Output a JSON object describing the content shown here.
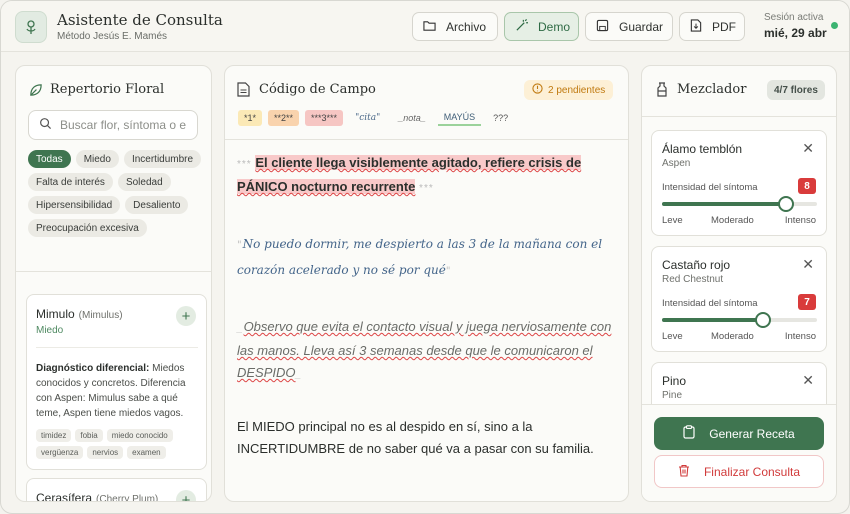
{
  "header": {
    "title": "Asistente de Consulta",
    "subtitle": "Método Jesús E. Mamés",
    "buttons": {
      "archivo": "Archivo",
      "demo": "Demo",
      "guardar": "Guardar",
      "pdf": "PDF"
    },
    "session_label": "Sesión activa",
    "session_date": "mié, 29 abr"
  },
  "repertorio": {
    "title": "Repertorio Floral",
    "search_placeholder": "Buscar flor, síntoma o e",
    "chips": [
      "Todas",
      "Miedo",
      "Incertidumbre",
      "Falta de interés",
      "Soledad",
      "Hipersensibilidad",
      "Desaliento",
      "Preocupación excesiva"
    ],
    "cards": [
      {
        "name": "Mimulo",
        "latin": "(Mimulus)",
        "category": "Miedo",
        "diff_label": "Diagnóstico diferencial:",
        "diff_text": " Miedos conocidos y concretos. Diferencia con Aspen: Mimulus sabe a qué teme, Aspen tiene miedos vagos.",
        "tags": [
          "timidez",
          "fobia",
          "miedo conocido",
          "vergüenza",
          "nervios",
          "examen"
        ]
      },
      {
        "name": "Cerasífera",
        "latin": "(Cherry Plum)"
      }
    ]
  },
  "codigo": {
    "title": "Código de Campo",
    "pending": "2 pendientes",
    "toolbar": [
      "*1*",
      "**2**",
      "***3***",
      "\"cita\"",
      "_nota_",
      "MAYÚS",
      "???"
    ],
    "p1_mark_open": "***",
    "p1_text": "El cliente llega visiblemente agitado, refiere crisis de PÁNICO nocturno recurrente",
    "p1_mark_close": "***",
    "p2_open": "\"",
    "p2_text": "No puedo dormir, me despierto a las 3 de la mañana con el corazón acelerado y no sé por qué",
    "p2_close": "\"",
    "p3_open": "_",
    "p3_text": "Observo que evita el contacto visual y juega nerviosamente con las manos. Lleva así 3 semanas desde que le comunicaron el DESPIDO",
    "p3_close": "_",
    "p4_text": "El MIEDO principal no es al despido en sí, sino a la INCERTIDUMBRE de no saber qué va a pasar con su familia."
  },
  "mezclador": {
    "title": "Mezclador",
    "count": "4/7 flores",
    "intensity_label": "Intensidad del síntoma",
    "scale": {
      "low": "Leve",
      "mid": "Moderado",
      "high": "Intenso"
    },
    "items": [
      {
        "name": "Álamo temblón",
        "latin": "Aspen",
        "value": "8",
        "level": 0.8
      },
      {
        "name": "Castaño rojo",
        "latin": "Red Chestnut",
        "value": "7",
        "level": 0.65
      },
      {
        "name": "Pino",
        "latin": "Pine"
      }
    ],
    "generate": "Generar Receta",
    "finish": "Finalizar Consulta"
  },
  "colors": {
    "accent": "#3f7550",
    "danger": "#d93b3b",
    "highlight": "#f8c9c9"
  }
}
